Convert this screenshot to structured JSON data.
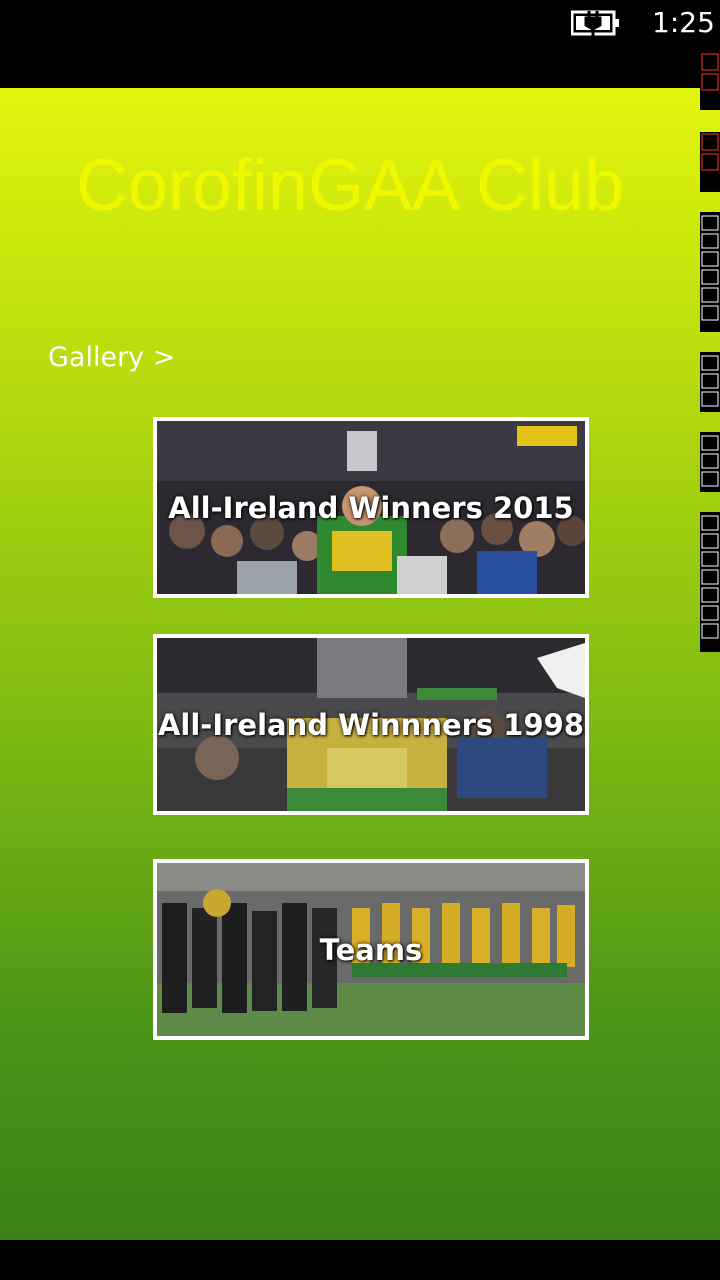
{
  "status_bar": {
    "time": "1:25",
    "battery_icon": "battery-charging-icon"
  },
  "header": {
    "title": "CorofinGAA Club",
    "title_color": "#eef900"
  },
  "nav": {
    "gallery_link": "Gallery >"
  },
  "tiles": [
    {
      "label": "All-Ireland Winners 2015"
    },
    {
      "label": "All-Ireland Winnners 1998"
    },
    {
      "label": "Teams"
    }
  ],
  "colors": {
    "gradient_top": "#e2f50c",
    "gradient_bottom": "#3a8119",
    "tile_border": "#ffffff"
  }
}
